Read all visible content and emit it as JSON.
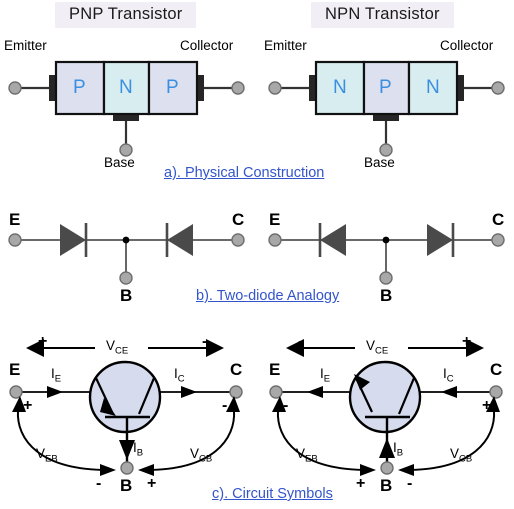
{
  "page": {
    "background": "#ffffff",
    "title_banner_bg": "#f2eef5",
    "caption_color": "#3355cc",
    "pn_letter_color": "#3b8fe0",
    "p_block_color": "#dde1ef",
    "n_block_color": "#d7edf0",
    "symbol_circle_color": "#d6dced",
    "terminal_dot_color": "#a8a8a8",
    "diode_color": "#4a4a4a",
    "wire_color": "#333333"
  },
  "titles": {
    "pnp": "PNP Transistor",
    "npn": "NPN Transistor"
  },
  "captions": {
    "a": "a).  Physical Construction",
    "b": "b).  Two-diode Analogy",
    "c": "c).  Circuit Symbols"
  },
  "section_a": {
    "pnp": {
      "emitter_label": "Emitter",
      "collector_label": "Collector",
      "base_label": "Base",
      "blocks": [
        {
          "letter": "P",
          "type": "p"
        },
        {
          "letter": "N",
          "type": "n"
        },
        {
          "letter": "P",
          "type": "p"
        }
      ]
    },
    "npn": {
      "emitter_label": "Emitter",
      "collector_label": "Collector",
      "base_label": "Base",
      "blocks": [
        {
          "letter": "N",
          "type": "n"
        },
        {
          "letter": "P",
          "type": "p"
        },
        {
          "letter": "N",
          "type": "n"
        }
      ]
    }
  },
  "section_b": {
    "pnp": {
      "e_label": "E",
      "c_label": "C",
      "b_label": "B",
      "left_diode_direction": "right",
      "right_diode_direction": "left"
    },
    "npn": {
      "e_label": "E",
      "c_label": "C",
      "b_label": "B",
      "left_diode_direction": "left",
      "right_diode_direction": "right"
    }
  },
  "section_c": {
    "pnp": {
      "e_label": "E",
      "c_label": "C",
      "b_label": "B",
      "vce_label": "V",
      "vce_sub": "CE",
      "veb_label": "V",
      "veb_sub": "EB",
      "vcb_label": "V",
      "vcb_sub": "CB",
      "ie_label": "I",
      "ie_sub": "E",
      "ic_label": "I",
      "ic_sub": "C",
      "ib_label": "I",
      "ib_sub": "B",
      "vce_left_sign": "+",
      "vce_right_sign": "-",
      "e_sign": "+",
      "c_sign": "-",
      "b_left_sign": "-",
      "b_right_sign": "+",
      "current_direction": "into-emitter"
    },
    "npn": {
      "e_label": "E",
      "c_label": "C",
      "b_label": "B",
      "vce_label": "V",
      "vce_sub": "CE",
      "veb_label": "V",
      "veb_sub": "EB",
      "vcb_label": "V",
      "vcb_sub": "CB",
      "ie_label": "I",
      "ie_sub": "E",
      "ic_label": "I",
      "ic_sub": "C",
      "ib_label": "I",
      "ib_sub": "B",
      "vce_left_sign": "-",
      "vce_right_sign": "+",
      "e_sign": "-",
      "c_sign": "+",
      "b_left_sign": "+",
      "b_right_sign": "-",
      "current_direction": "out-of-emitter"
    }
  }
}
